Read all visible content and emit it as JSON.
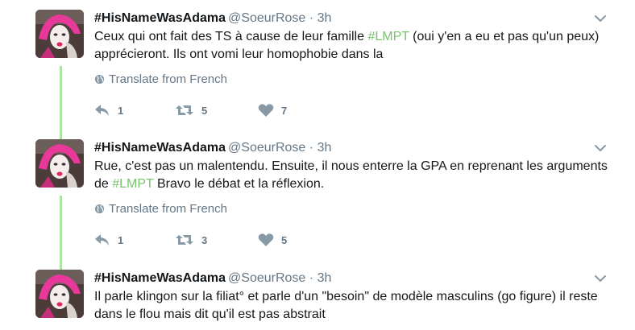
{
  "tweets": [
    {
      "name": "#HisNameWasAdama",
      "handle": "@SoeurRose",
      "separator": "·",
      "time": "3h",
      "text_before": "Ceux qui ont fait des TS à cause de leur famille ",
      "hashtag": "#LMPT",
      "text_after": " (oui y'en a eu et pas qu'un peux) apprécieront. Ils ont vomi leur homophobie dans la",
      "translate_label": "Translate from French",
      "reply_count": "1",
      "retweet_count": "5",
      "like_count": "7"
    },
    {
      "name": "#HisNameWasAdama",
      "handle": "@SoeurRose",
      "separator": "·",
      "time": "3h",
      "text_before": "Rue, c'est pas un malentendu. Ensuite, il nous enterre la GPA en reprenant les arguments de ",
      "hashtag": "#LMPT",
      "text_after": " Bravo le débat et la réflexion.",
      "translate_label": "Translate from French",
      "reply_count": "1",
      "retweet_count": "3",
      "like_count": "5"
    },
    {
      "name": "#HisNameWasAdama",
      "handle": "@SoeurRose",
      "separator": "·",
      "time": "3h",
      "text_before": "Il parle klingon sur la filiat° et parle d'un \"besoin\" de modèle masculins (go figure) il reste dans le flou mais dit qu'il est pas abstrait",
      "hashtag": "",
      "text_after": ""
    }
  ],
  "colors": {
    "thread_line": "#aee3a6",
    "hashtag": "#79c36c",
    "meta_gray": "#657786",
    "action_gray": "#8899a6"
  },
  "icons": [
    "globe-icon",
    "reply-icon",
    "retweet-icon",
    "like-icon",
    "chevron-down-icon"
  ]
}
